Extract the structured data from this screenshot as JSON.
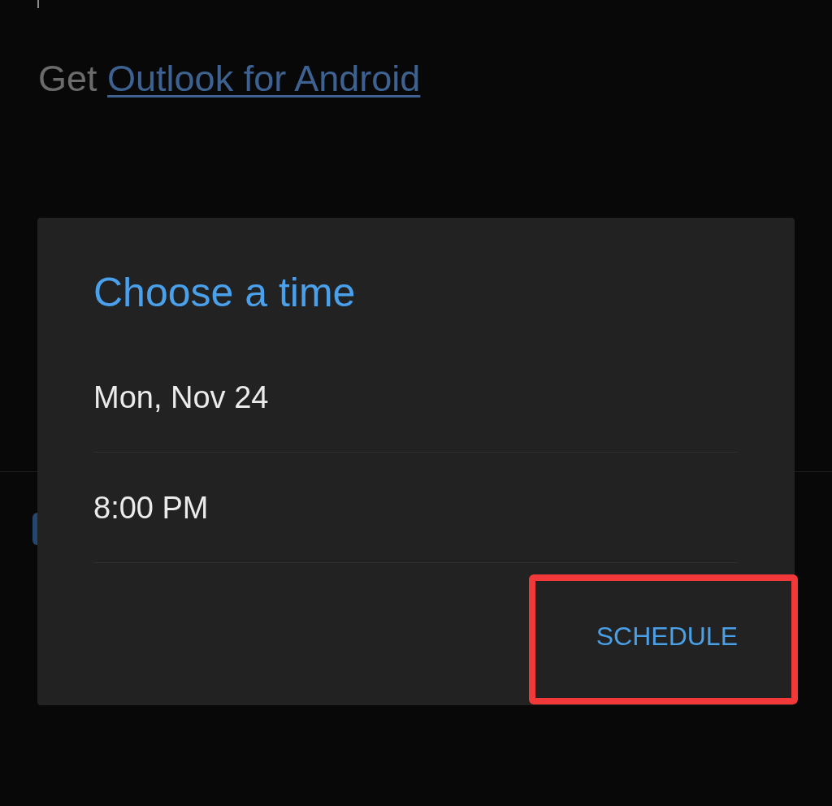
{
  "compose": {
    "signature": {
      "text": "Get",
      "link": "Outlook for Android"
    }
  },
  "dialog": {
    "title": "Choose a time",
    "fields": [
      {
        "value": "Mon, Nov 24"
      },
      {
        "value": "8:00 PM"
      }
    ],
    "actions": [
      {
        "label": "SCHEDULE",
        "highlighted": true
      }
    ]
  }
}
